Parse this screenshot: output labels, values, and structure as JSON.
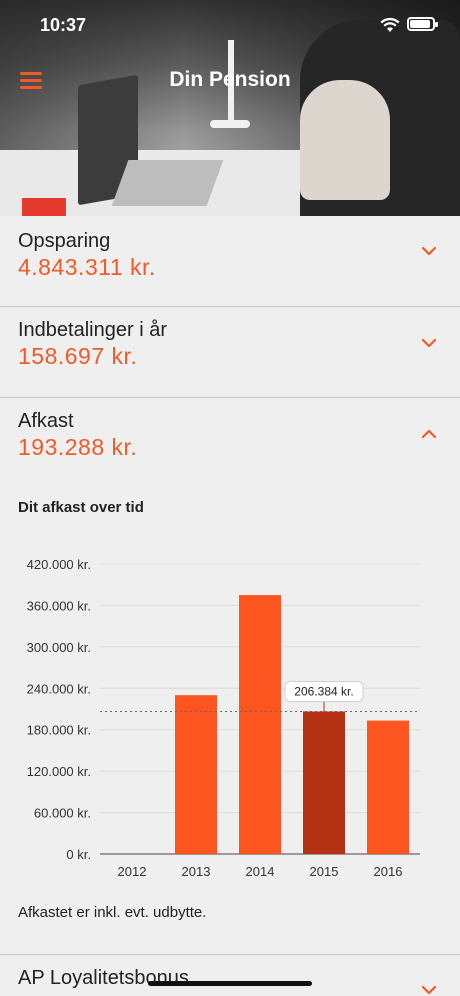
{
  "status": {
    "time": "10:37"
  },
  "nav": {
    "title": "Din Pension"
  },
  "sections": [
    {
      "label": "Opsparing",
      "value": "4.843.311 kr.",
      "expanded": false
    },
    {
      "label": "Indbetalinger i år",
      "value": "158.697 kr.",
      "expanded": false
    },
    {
      "label": "Afkast",
      "value": "193.288 kr.",
      "expanded": true
    },
    {
      "label": "AP Loyalitetsbonus",
      "value": "",
      "expanded": false
    }
  ],
  "afkast": {
    "chart_title": "Dit afkast over tid",
    "footnote": "Afkastet er inkl. evt. udbytte."
  },
  "colors": {
    "accent": "#f05a28",
    "bar": "#fc5520",
    "bar_selected": "#b53113"
  },
  "chart_data": {
    "type": "bar",
    "title": "Dit afkast over tid",
    "categories": [
      "2012",
      "2013",
      "2014",
      "2015",
      "2016"
    ],
    "values": [
      0,
      230000,
      375000,
      206384,
      193288
    ],
    "ylim": [
      0,
      420000
    ],
    "yticks": [
      "0 kr.",
      "60.000 kr.",
      "120.000 kr.",
      "180.000 kr.",
      "240.000 kr.",
      "300.000 kr.",
      "360.000 kr.",
      "420.000 kr."
    ],
    "ytick_values": [
      0,
      60000,
      120000,
      180000,
      240000,
      300000,
      360000,
      420000
    ],
    "selected_index": 3,
    "tooltip": "206.384 kr.",
    "grid": true
  }
}
